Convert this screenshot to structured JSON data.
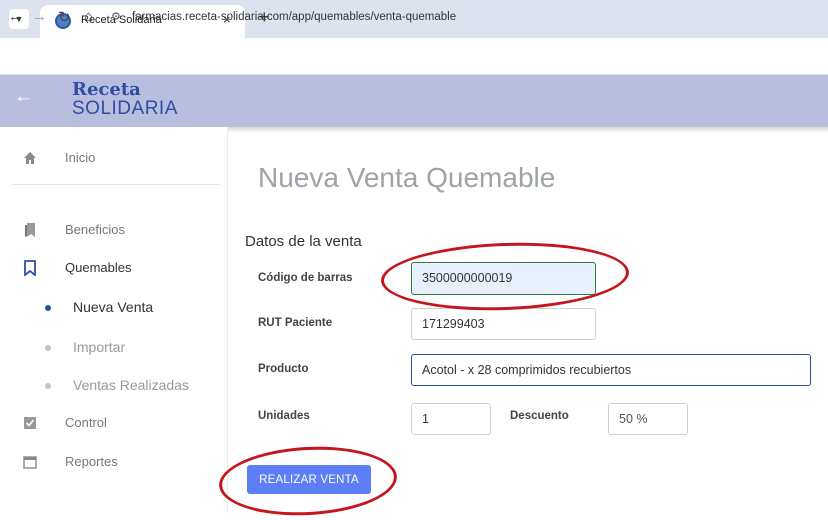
{
  "browser": {
    "tab_title": "Receta Solidaria",
    "tab_close": "×",
    "new_tab": "+",
    "url": "farmacias.receta-solidaria.com/app/quemables/venta-quemable"
  },
  "header": {
    "logo_top": "Receta",
    "logo_bottom": "SOLIDARIA",
    "brand_color": "#2e4ea3"
  },
  "sidebar": {
    "items": [
      {
        "label": "Inicio",
        "icon": "home-icon"
      },
      {
        "label": "Beneficios",
        "icon": "bookmarks-icon"
      },
      {
        "label": "Quemables",
        "icon": "bookmark-icon"
      },
      {
        "label": "Nueva Venta",
        "icon": "bullet"
      },
      {
        "label": "Importar",
        "icon": "bullet"
      },
      {
        "label": "Ventas Realizadas",
        "icon": "bullet"
      },
      {
        "label": "Control",
        "icon": "checkbox-icon"
      },
      {
        "label": "Reportes",
        "icon": "calendar-icon"
      }
    ]
  },
  "main": {
    "title": "Nueva Venta Quemable",
    "section_title": "Datos de la venta",
    "form": {
      "barcode_label": "Código de barras",
      "barcode_value": "3500000000019",
      "rut_label": "RUT Paciente",
      "rut_value": "171299403",
      "product_label": "Producto",
      "product_value": "Acotol - x 28 comprimidos recubiertos",
      "units_label": "Unidades",
      "units_value": "1",
      "discount_label": "Descuento",
      "discount_value": "50 %"
    },
    "submit_label": "REALIZAR VENTA"
  },
  "colors": {
    "header_bg": "#b9bedf",
    "button_bg": "#5c7ef6",
    "annotation": "#c4161c",
    "barcode_border": "#2e7d32"
  }
}
